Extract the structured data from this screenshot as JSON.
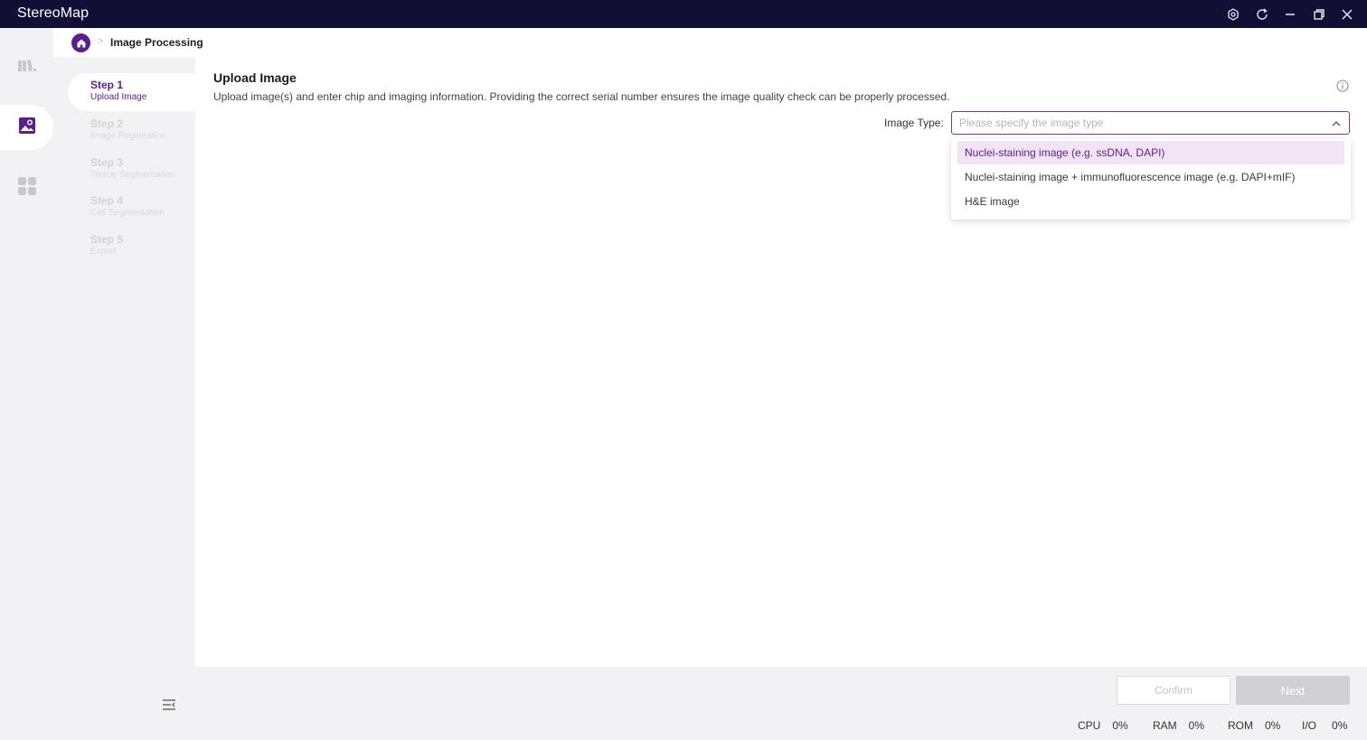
{
  "app": {
    "title": "StereoMap"
  },
  "window_controls": {
    "icons": [
      "settings-icon",
      "refresh-icon",
      "minimize-icon",
      "restore-icon",
      "close-icon"
    ]
  },
  "rail": {
    "items": [
      {
        "icon": "map-book-icon",
        "active": false
      },
      {
        "icon": "image-processing-icon",
        "active": true
      },
      {
        "icon": "apps-grid-icon",
        "active": false
      }
    ]
  },
  "breadcrumb": {
    "home_icon": "home-icon",
    "separator": ">",
    "current": "Image Processing"
  },
  "steps": [
    {
      "title": "Step 1",
      "subtitle": "Upload Image",
      "active": true
    },
    {
      "title": "Step 2",
      "subtitle": "Image Registration",
      "active": false
    },
    {
      "title": "Step 3",
      "subtitle": "Tissue Segmentation",
      "active": false
    },
    {
      "title": "Step 4",
      "subtitle": "Cell Segmentation",
      "active": false
    },
    {
      "title": "Step 5",
      "subtitle": "Export",
      "active": false
    }
  ],
  "main": {
    "title": "Upload Image",
    "description": "Upload image(s) and enter chip and imaging information. Providing the correct serial number ensures the image quality check can be properly processed.",
    "image_type": {
      "label": "Image Type:",
      "placeholder": "Please specify the image type",
      "options": [
        "Nuclei-staining image (e.g. ssDNA, DAPI)",
        "Nuclei-staining image + immunofluorescence image (e.g. DAPI+mIF)",
        "H&E image"
      ],
      "highlighted_index": 0
    }
  },
  "footer": {
    "confirm_label": "Confirm",
    "next_label": "Next",
    "stats": [
      {
        "label": "CPU",
        "value": "0%"
      },
      {
        "label": "RAM",
        "value": "0%"
      },
      {
        "label": "ROM",
        "value": "0%"
      },
      {
        "label": "I/O",
        "value": "0%"
      }
    ]
  },
  "colors": {
    "titlebar": "#110f33",
    "accent": "#5b1e8f",
    "highlight": "#f1e4f4",
    "panel": "#f2f2f4"
  }
}
